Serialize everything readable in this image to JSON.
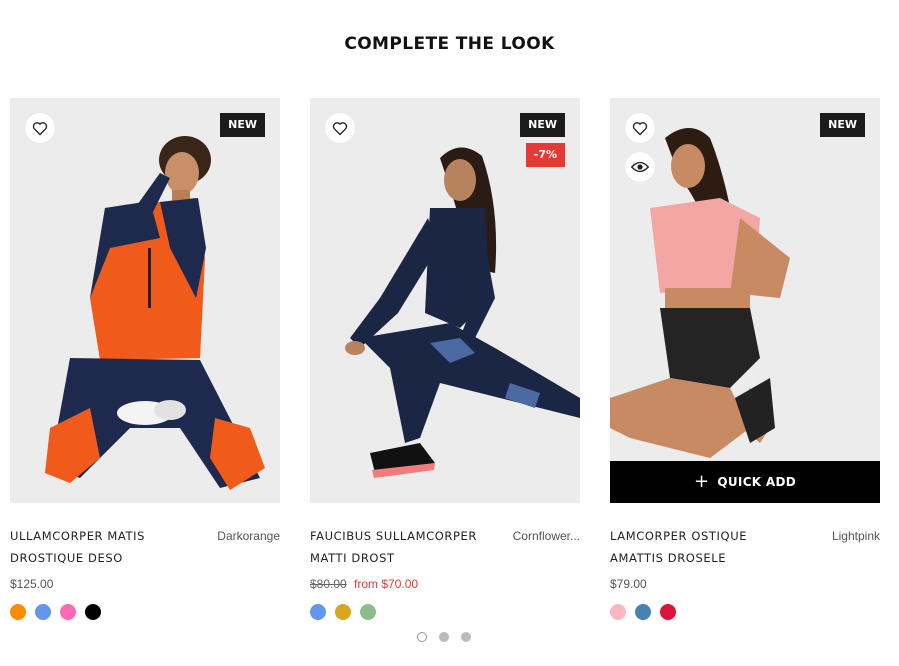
{
  "section": {
    "title": "COMPLETE THE LOOK"
  },
  "products": [
    {
      "name": "ULLAMCORPER MATIS DROSTIQUE DESO",
      "color_name": "Darkorange",
      "badges": [
        "NEW"
      ],
      "price": "$125.00",
      "swatches": [
        "#ff8c00",
        "#6495ed",
        "#ff69b4",
        "#000000"
      ]
    },
    {
      "name": "FAUCIBUS SULLAMCORPER MATTI DROST",
      "color_name": "Cornflower...",
      "badges": [
        "NEW",
        "-7%"
      ],
      "old_price": "$80.00",
      "sale_price": "from $70.00",
      "swatches": [
        "#6495ed",
        "#daa520",
        "#8fbc8f"
      ]
    },
    {
      "name": "LAMCORPER OSTIQUE AMATTIS DROSELE",
      "color_name": "Lightpink",
      "badges": [
        "NEW"
      ],
      "price": "$79.00",
      "quick_add_label": "QUICK ADD",
      "swatches": [
        "#ffb6c1",
        "#4682b4",
        "#dc143c"
      ]
    }
  ],
  "carousel": {
    "pages": 3,
    "active": 1
  },
  "icons": {
    "wishlist": "heart-icon",
    "quickview": "eye-icon",
    "add": "plus-icon"
  },
  "colors": {
    "sale": "#e53935",
    "badge_dark": "#1b1b1b"
  }
}
